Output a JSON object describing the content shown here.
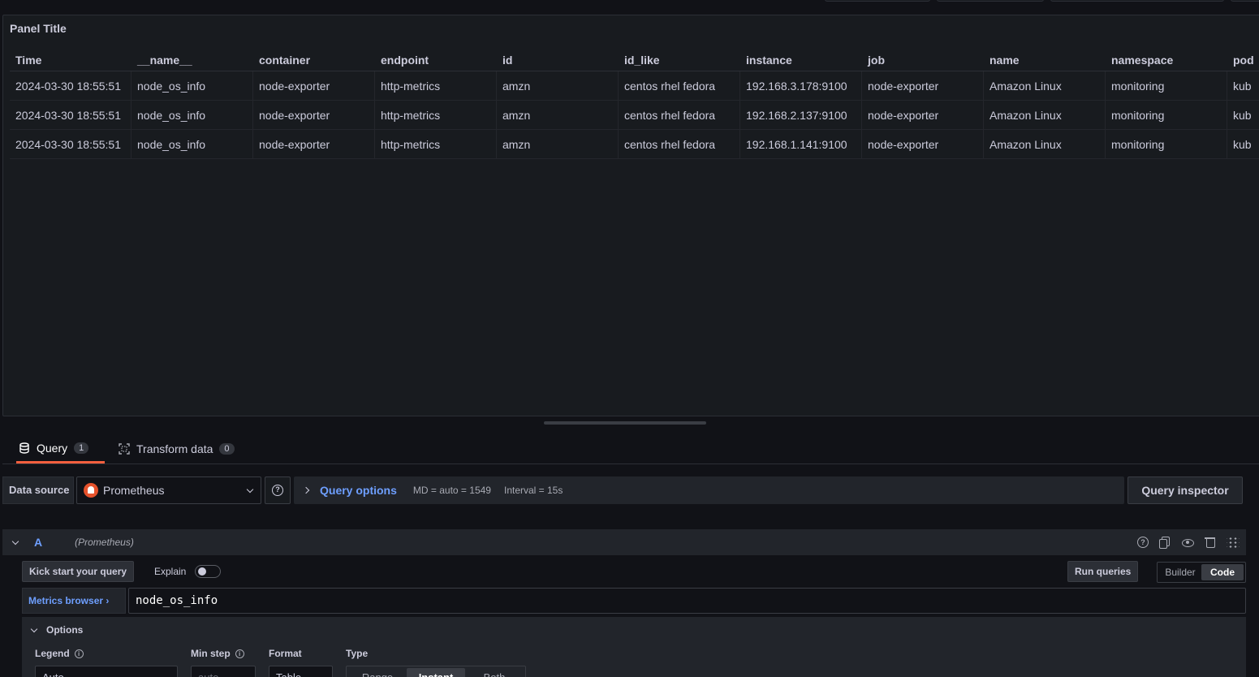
{
  "panel": {
    "title": "Panel Title",
    "columns": [
      "Time",
      "__name__",
      "container",
      "endpoint",
      "id",
      "id_like",
      "instance",
      "job",
      "name",
      "namespace",
      "pod"
    ],
    "rows": [
      [
        "2024-03-30 18:55:51",
        "node_os_info",
        "node-exporter",
        "http-metrics",
        "amzn",
        "centos rhel fedora",
        "192.168.3.178:9100",
        "node-exporter",
        "Amazon Linux",
        "monitoring",
        "kub"
      ],
      [
        "2024-03-30 18:55:51",
        "node_os_info",
        "node-exporter",
        "http-metrics",
        "amzn",
        "centos rhel fedora",
        "192.168.2.137:9100",
        "node-exporter",
        "Amazon Linux",
        "monitoring",
        "kub"
      ],
      [
        "2024-03-30 18:55:51",
        "node_os_info",
        "node-exporter",
        "http-metrics",
        "amzn",
        "centos rhel fedora",
        "192.168.1.141:9100",
        "node-exporter",
        "Amazon Linux",
        "monitoring",
        "kub"
      ]
    ]
  },
  "tabs": [
    {
      "label": "Query",
      "count": "1",
      "icon": "database-icon"
    },
    {
      "label": "Transform data",
      "count": "0",
      "icon": "transform-icon"
    }
  ],
  "datasource": {
    "label": "Data source",
    "selected": "Prometheus",
    "icon": "prometheus-logo"
  },
  "query_options": {
    "label": "Query options",
    "md": "MD = auto = 1549",
    "interval": "Interval = 15s"
  },
  "query_inspector": "Query inspector",
  "query_row": {
    "ref": "A",
    "datasource_hint": "(Prometheus)"
  },
  "editor": {
    "kick_start": "Kick start your query",
    "explain": "Explain",
    "run_queries": "Run queries",
    "modes": [
      "Builder",
      "Code"
    ],
    "active_mode": "Code",
    "metrics_browser": "Metrics browser ›",
    "query": "node_os_info"
  },
  "options": {
    "title": "Options",
    "legend_label": "Legend",
    "legend_value": "Auto",
    "minstep_label": "Min step",
    "minstep_placeholder": "auto",
    "format_label": "Format",
    "format_value": "Table",
    "type_label": "Type",
    "type_options": [
      "Range",
      "Instant",
      "Both"
    ],
    "type_active": "Instant"
  },
  "colors": {
    "accent": "#f55f3e",
    "link": "#6e9fff",
    "background": "#111217",
    "panel": "#181b1f"
  }
}
